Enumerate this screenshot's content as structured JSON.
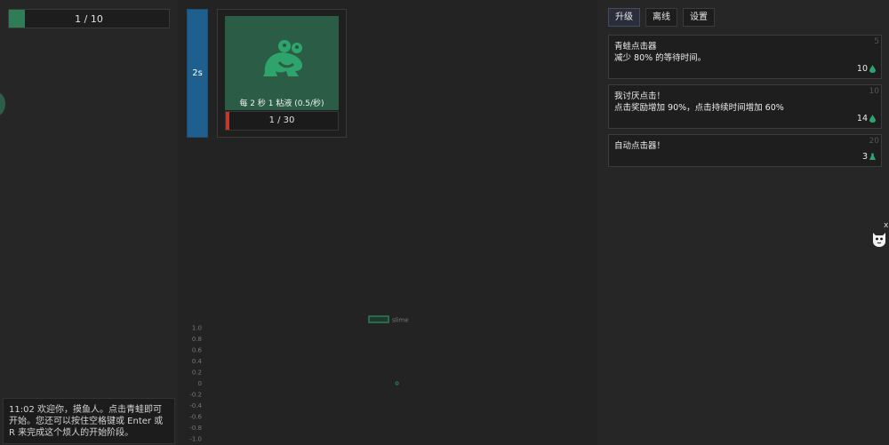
{
  "left": {
    "progress": {
      "label": "1 / 10",
      "fraction": 0.1
    },
    "log": {
      "time": "11:02",
      "message": "欢迎你，摸鱼人。点击青蛙即可开始。您还可以按住空格键或 Enter 或 R 来完成这个烦人的开始阶段。"
    }
  },
  "middle": {
    "timer": {
      "label": "2s"
    },
    "frog": {
      "icon": "frog-icon",
      "caption": "每 2 秒 1 粘液 (0.5/秒)",
      "counter": "1 / 30"
    }
  },
  "chart_data": {
    "type": "line",
    "series": [
      {
        "name": "slime",
        "x": [
          0
        ],
        "values": [
          0
        ]
      }
    ],
    "ylim": [
      -1.0,
      1.0
    ],
    "yticks": [
      "1.0",
      "0.8",
      "0.6",
      "0.4",
      "0.2",
      "0",
      "-0.2",
      "-0.4",
      "-0.6",
      "-0.8",
      "-1.0"
    ],
    "legend": "top-center",
    "grid": false,
    "colors": {
      "slime": "#2f7d57"
    }
  },
  "right": {
    "tabs": [
      {
        "label": "升级",
        "active": true
      },
      {
        "label": "离线",
        "active": false
      },
      {
        "label": "设置",
        "active": false
      }
    ],
    "upgrades": [
      {
        "num": "5",
        "title": "青蛙点击器",
        "desc": "减少 80% 的等待时间。",
        "cost": "10",
        "cost_icon": "slime-drop-icon"
      },
      {
        "num": "10",
        "title": "我讨厌点击！",
        "desc": "点击奖励增加 90%，点击持续时间增加 60%",
        "cost": "14",
        "cost_icon": "slime-drop-icon"
      },
      {
        "num": "20",
        "title": "自动点击器！",
        "desc": "",
        "cost": "3",
        "cost_icon": "flask-icon"
      }
    ]
  },
  "side": {
    "close_label": "x",
    "icon": "cat-badge-icon"
  }
}
